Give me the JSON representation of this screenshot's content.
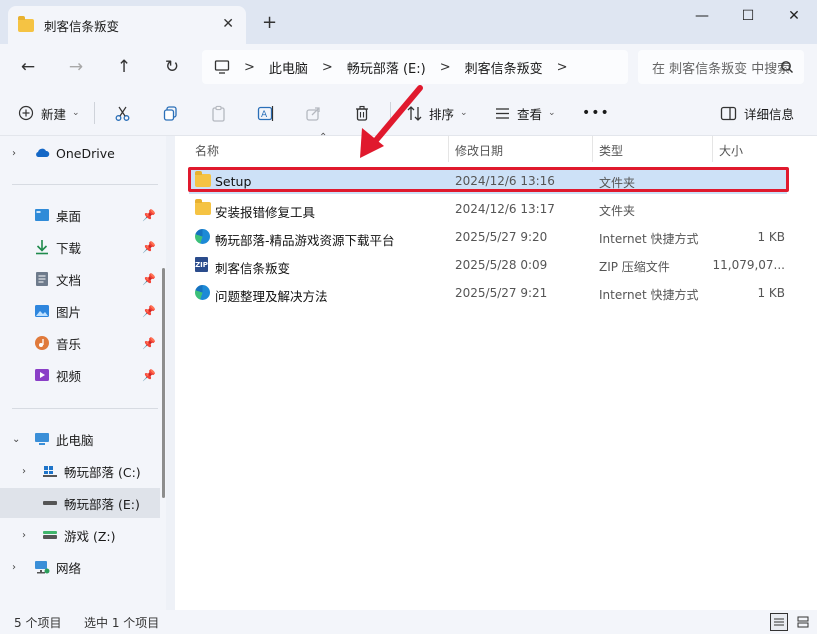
{
  "window": {
    "tab_title": "刺客信条叛变",
    "tab_close": "✕",
    "new_tab": "+",
    "minimize": "—",
    "maximize": "☐",
    "close": "✕"
  },
  "nav": {
    "back": "←",
    "forward": "→",
    "up": "↑",
    "refresh": "↻",
    "breadcrumb": [
      "此电脑",
      "畅玩部落 (E:)",
      "刺客信条叛变"
    ],
    "breadcrumb_sep": ">",
    "search_placeholder": "在 刺客信条叛变 中搜索"
  },
  "toolbar": {
    "new_label": "新建",
    "sort_label": "排序",
    "view_label": "查看",
    "more": "•••",
    "details_label": "详细信息"
  },
  "sidebar": {
    "onedrive": "OneDrive",
    "quick": [
      {
        "label": "桌面",
        "icon": "desktop-icon"
      },
      {
        "label": "下载",
        "icon": "download-icon"
      },
      {
        "label": "文档",
        "icon": "document-icon"
      },
      {
        "label": "图片",
        "icon": "picture-icon"
      },
      {
        "label": "音乐",
        "icon": "music-icon"
      },
      {
        "label": "视频",
        "icon": "video-icon"
      }
    ],
    "this_pc": "此电脑",
    "drives": [
      {
        "label": "畅玩部落 (C:)"
      },
      {
        "label": "畅玩部落 (E:)"
      },
      {
        "label": "游戏 (Z:)"
      }
    ],
    "network": "网络"
  },
  "columns": {
    "name": "名称",
    "date": "修改日期",
    "type": "类型",
    "size": "大小"
  },
  "files": [
    {
      "name": "Setup",
      "date": "2024/12/6 13:16",
      "type": "文件夹",
      "size": "",
      "icon": "folder-icon",
      "selected": true
    },
    {
      "name": "安装报错修复工具",
      "date": "2024/12/6 13:17",
      "type": "文件夹",
      "size": "",
      "icon": "folder-icon"
    },
    {
      "name": "畅玩部落-精品游戏资源下载平台",
      "date": "2025/5/27 9:20",
      "type": "Internet 快捷方式",
      "size": "1 KB",
      "icon": "edge-shortcut-icon"
    },
    {
      "name": "刺客信条叛变",
      "date": "2025/5/28 0:09",
      "type": "ZIP 压缩文件",
      "size": "11,079,07...",
      "icon": "zip-icon"
    },
    {
      "name": "问题整理及解决方法",
      "date": "2025/5/27 9:21",
      "type": "Internet 快捷方式",
      "size": "1 KB",
      "icon": "edge-shortcut-icon"
    }
  ],
  "status": {
    "count": "5 个项目",
    "selected": "选中 1 个项目"
  },
  "colors": {
    "selection": "#cde1f7",
    "highlight_box": "#e0192d",
    "arrow": "#e0192d"
  }
}
